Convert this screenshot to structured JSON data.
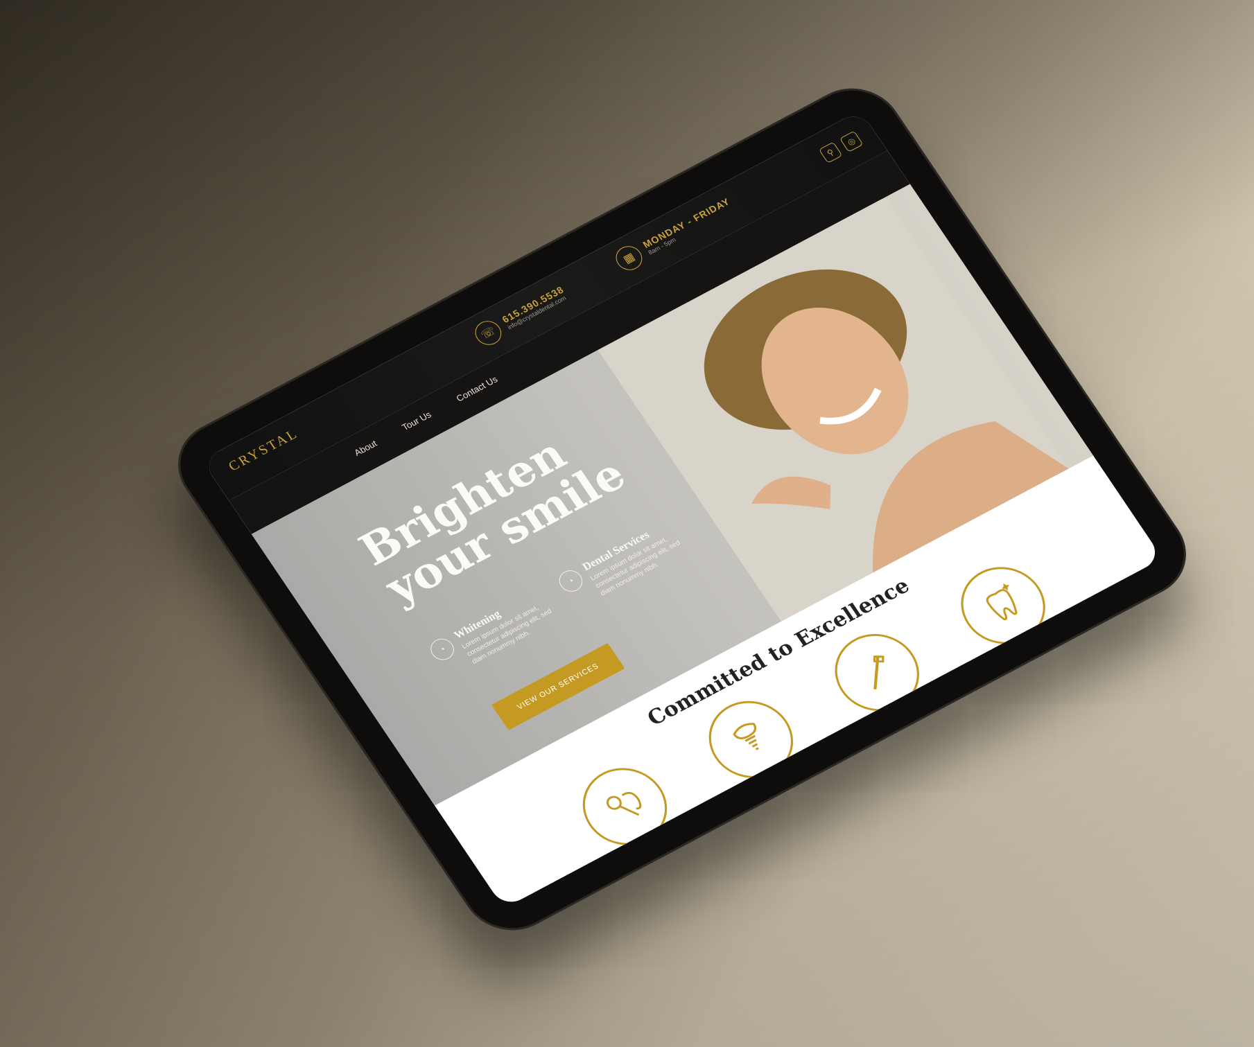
{
  "header": {
    "logo": "CRYSTAL",
    "phone": "615.390.5538",
    "phone_sub": "info@crystaldental.com",
    "hours": "MONDAY - FRIDAY",
    "hours_sub": "8am - 5pm"
  },
  "nav": {
    "items": [
      "About",
      "Tour Us",
      "Contact Us"
    ]
  },
  "hero": {
    "headline_line1": "Brighten",
    "headline_line2": "your smile",
    "services": [
      {
        "title": "Whitening",
        "desc": "Lorem ipsum dolor sit amet, consectetur adipiscing elit, sed diam nonummy nibh."
      },
      {
        "title": "Dental Services",
        "desc": "Lorem ipsum dolor sit amet, consectetur adipiscing elit, sed diam nonummy nibh."
      }
    ],
    "cta_label": "VIEW OUR SERVICES"
  },
  "section": {
    "title": "Committed to Excellence"
  },
  "icons": {
    "phone": "tooth-phone-icon",
    "hours": "calendar-icon",
    "pin": "location-pin-icon",
    "social": "instagram-icon",
    "badges": [
      "dental-mirror-icon",
      "implant-icon",
      "toothbrush-icon",
      "tooth-sparkle-icon"
    ]
  },
  "colors": {
    "accent": "#c49a22",
    "dark": "#151413"
  }
}
